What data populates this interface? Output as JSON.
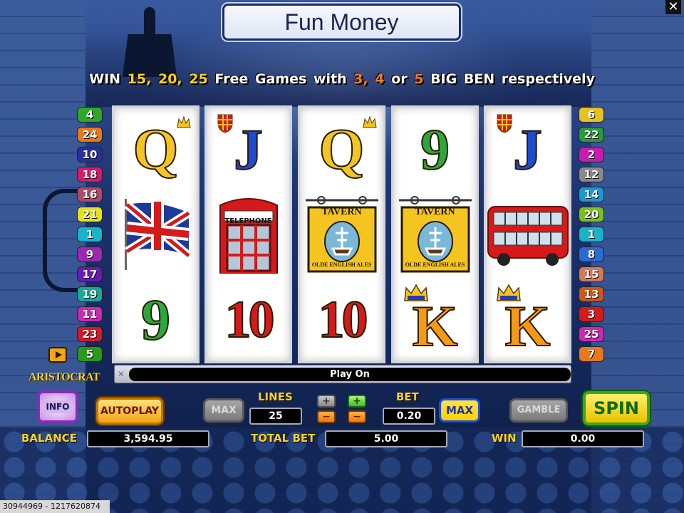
{
  "title": "Fun Money",
  "banner": {
    "w1": "WIN",
    "n1": "15,",
    "n2": "20,",
    "n3": "25",
    "w2": "Free Games with",
    "c1": "3,",
    "c2": "4",
    "w3": "or",
    "c3": "5",
    "w4": "BIG BEN respectively"
  },
  "close_label": "✕",
  "left_lines": [
    {
      "n": "4",
      "color": "#2fa82a"
    },
    {
      "n": "24",
      "color": "#e8781a"
    },
    {
      "n": "10",
      "color": "#2a2f9a"
    },
    {
      "n": "18",
      "color": "#d61a6a"
    },
    {
      "n": "16",
      "color": "#b04a6a"
    },
    {
      "n": "21",
      "color": "#e6e218"
    },
    {
      "n": "1",
      "color": "#1ab3c9"
    },
    {
      "n": "9",
      "color": "#9a2ab0"
    },
    {
      "n": "17",
      "color": "#6a1ab3"
    },
    {
      "n": "19",
      "color": "#1aa89a"
    },
    {
      "n": "11",
      "color": "#c92ab3"
    },
    {
      "n": "23",
      "color": "#d41a2a"
    },
    {
      "n": "5",
      "color": "#2a9a1a"
    }
  ],
  "right_lines": [
    {
      "n": "6",
      "color": "#e8c21a"
    },
    {
      "n": "22",
      "color": "#2a9a3a"
    },
    {
      "n": "2",
      "color": "#c91ab3"
    },
    {
      "n": "12",
      "color": "#8a8a8a"
    },
    {
      "n": "14",
      "color": "#1a9ad4"
    },
    {
      "n": "20",
      "color": "#7ac21a"
    },
    {
      "n": "1",
      "color": "#1ab3c9"
    },
    {
      "n": "8",
      "color": "#2a6ad4"
    },
    {
      "n": "15",
      "color": "#d4785a"
    },
    {
      "n": "13",
      "color": "#c9581a"
    },
    {
      "n": "3",
      "color": "#d41a1a"
    },
    {
      "n": "25",
      "color": "#c92ab3"
    },
    {
      "n": "7",
      "color": "#e8781a"
    }
  ],
  "reels": [
    [
      "Q",
      "union-jack-flag",
      "9"
    ],
    [
      "J",
      "telephone-booth",
      "10"
    ],
    [
      "Q",
      "tavern-sign",
      "10"
    ],
    [
      "9",
      "tavern-sign",
      "K"
    ],
    [
      "J",
      "double-decker-bus",
      "K"
    ]
  ],
  "symbol_text": {
    "telephone": "TELEPHONE",
    "tavern": "TAVERN",
    "tavern_sub": "OLDE ENGLISH ALES"
  },
  "status": "Play On",
  "logo": "ARISTOCRAT",
  "buttons": {
    "info": "INFO",
    "autoplay": "AUTOPLAY",
    "max_lines": "MAX",
    "max_bet": "MAX",
    "gamble": "GAMBLE",
    "spin": "SPIN",
    "plus": "+",
    "minus": "−"
  },
  "lines": {
    "label": "LINES",
    "value": "25"
  },
  "bet": {
    "label": "BET",
    "value": "0.20"
  },
  "balance": {
    "label": "BALANCE",
    "value": "3,594.95"
  },
  "total_bet": {
    "label": "TOTAL BET",
    "value": "5.00"
  },
  "win": {
    "label": "WIN",
    "value": "0.00"
  },
  "session_id": "30944969 - 1217620874"
}
